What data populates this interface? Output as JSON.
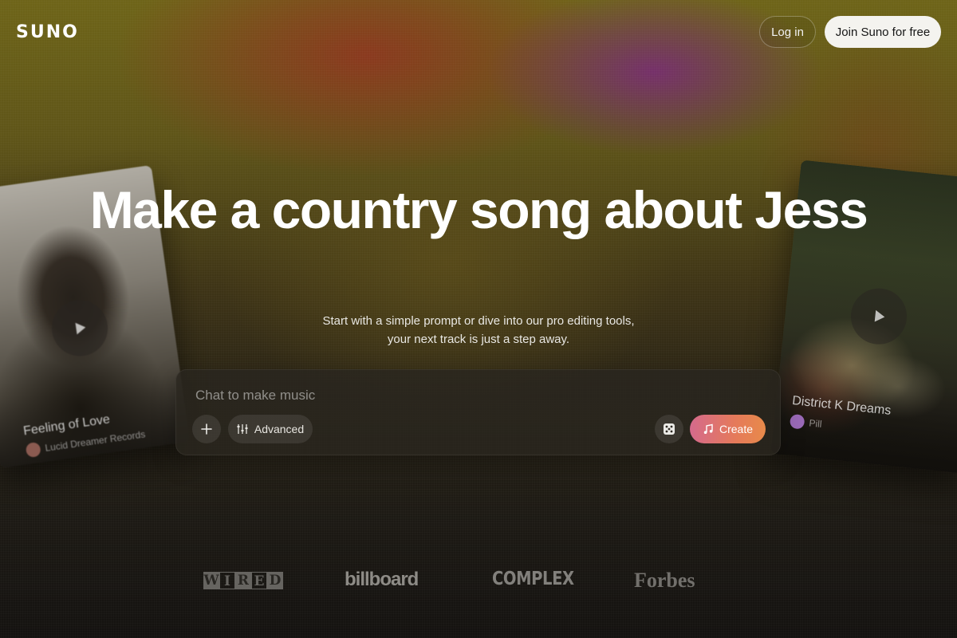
{
  "header": {
    "logo": "SUNO",
    "login_label": "Log in",
    "join_label": "Join Suno for free"
  },
  "hero": {
    "headline": "Make a country song about Jess",
    "subtext": "Start with a simple prompt or dive into our pro editing tools, your next track is just a step away."
  },
  "chat": {
    "placeholder": "Chat to make music",
    "advanced_label": "Advanced",
    "create_label": "Create"
  },
  "cards": [
    {
      "title": "Feeling of Love",
      "artist": "Lucid Dreamer Records"
    },
    {
      "title": "District K Dreams",
      "artist": "Pill"
    }
  ],
  "press": [
    "WIRED",
    "billboard",
    "COMPLEX",
    "Forbes"
  ],
  "colors": {
    "join_button_bg": "#f4f3ef",
    "create_gradient_start": "#d56a8c",
    "create_gradient_end": "#e88a4a"
  },
  "icons": [
    "plus-icon",
    "sliders-icon",
    "dice-icon",
    "music-note-icon",
    "play-icon"
  ]
}
